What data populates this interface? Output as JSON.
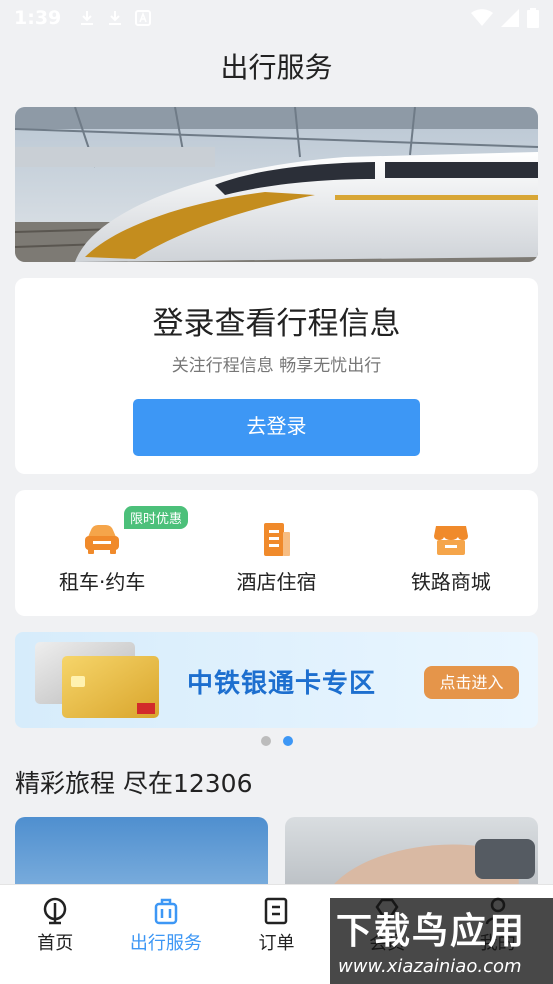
{
  "status_bar": {
    "time": "1:39",
    "icons": [
      "download-icon",
      "download-icon",
      "font-icon"
    ],
    "right_icons": [
      "wifi-icon",
      "signal-icon",
      "battery-icon"
    ]
  },
  "header": {
    "title": "出行服务"
  },
  "login": {
    "title": "登录查看行程信息",
    "subtitle": "关注行程信息 畅享无忧出行",
    "button": "去登录"
  },
  "services": [
    {
      "label": "租车·约车",
      "icon": "car-icon",
      "tag": "限时优惠",
      "color": "#f08a2b"
    },
    {
      "label": "酒店住宿",
      "icon": "hotel-icon",
      "color": "#f08a2b"
    },
    {
      "label": "铁路商城",
      "icon": "shop-icon",
      "color": "#f08a2b"
    }
  ],
  "promo_banner": {
    "text": "中铁银通卡专区",
    "button": "点击进入"
  },
  "carousel": {
    "current": 2,
    "total": 2
  },
  "section": {
    "title": "精彩旅程 尽在12306"
  },
  "tabs": [
    {
      "label": "首页",
      "icon": "railway-logo-icon",
      "active": false
    },
    {
      "label": "出行服务",
      "icon": "luggage-icon",
      "active": true
    },
    {
      "label": "订单",
      "icon": "order-icon",
      "active": false
    },
    {
      "label": "会员",
      "icon": "diamond-icon",
      "active": false
    },
    {
      "label": "我的",
      "icon": "user-icon",
      "active": false
    }
  ],
  "watermark": {
    "main": "下载鸟应用",
    "url": "www.xiazainiao.com"
  },
  "colors": {
    "accent": "#3d97f5",
    "tag_green": "#4cc07a",
    "orange": "#f08a2b"
  }
}
